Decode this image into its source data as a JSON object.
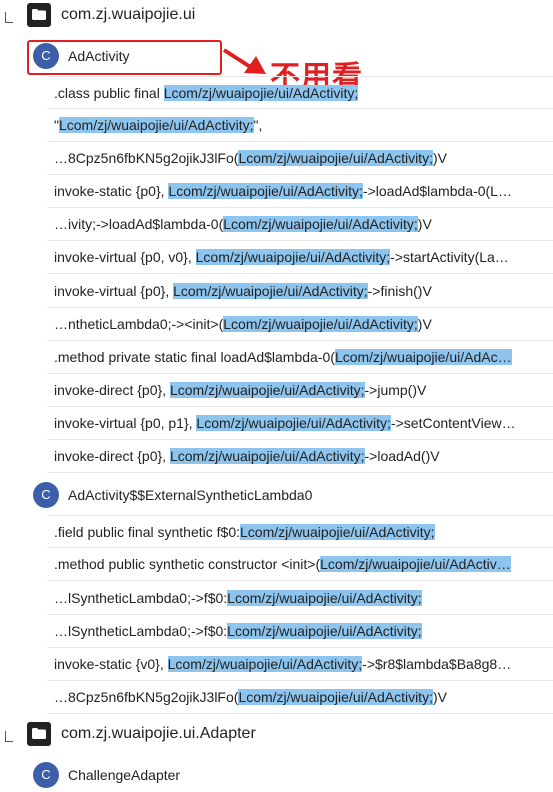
{
  "annotation": {
    "note": "不用看",
    "box_color": "#e02020"
  },
  "colors": {
    "highlight": "#8ec5ef",
    "class_icon": "#3d5ea8"
  },
  "tree": [
    {
      "kind": "package",
      "label": "com.zj.wuaipojie.ui"
    },
    {
      "kind": "class",
      "icon": "C",
      "label": "AdActivity",
      "hits": [
        {
          "pre": ".class public final ",
          "match": "Lcom/zj/wuaipojie/ui/AdActivity;",
          "post": ""
        },
        {
          "pre": "\"",
          "match": "Lcom/zj/wuaipojie/ui/AdActivity;",
          "post": "\","
        },
        {
          "pre": "…8Cpz5n6fbKN5g2ojikJ3lFo(",
          "match": "Lcom/zj/wuaipojie/ui/AdActivity;",
          "post": ")V"
        },
        {
          "pre": "invoke-static {p0}, ",
          "match": "Lcom/zj/wuaipojie/ui/AdActivity;",
          "post": "->loadAd$lambda-0(L…"
        },
        {
          "pre": "…ivity;->loadAd$lambda-0(",
          "match": "Lcom/zj/wuaipojie/ui/AdActivity;",
          "post": ")V"
        },
        {
          "pre": "invoke-virtual {p0, v0}, ",
          "match": "Lcom/zj/wuaipojie/ui/AdActivity;",
          "post": "->startActivity(La…"
        },
        {
          "pre": "invoke-virtual {p0}, ",
          "match": "Lcom/zj/wuaipojie/ui/AdActivity;",
          "post": "->finish()V"
        },
        {
          "pre": "…ntheticLambda0;-><init>(",
          "match": "Lcom/zj/wuaipojie/ui/AdActivity;",
          "post": ")V"
        },
        {
          "pre": ".method private static final loadAd$lambda-0(",
          "match": "Lcom/zj/wuaipojie/ui/AdAc…",
          "post": ""
        },
        {
          "pre": "invoke-direct {p0}, ",
          "match": "Lcom/zj/wuaipojie/ui/AdActivity;",
          "post": "->jump()V"
        },
        {
          "pre": "invoke-virtual {p0, p1}, ",
          "match": "Lcom/zj/wuaipojie/ui/AdActivity;",
          "post": "->setContentView…"
        },
        {
          "pre": "invoke-direct {p0}, ",
          "match": "Lcom/zj/wuaipojie/ui/AdActivity;",
          "post": "->loadAd()V"
        }
      ]
    },
    {
      "kind": "class",
      "icon": "C",
      "label": "AdActivity$$ExternalSyntheticLambda0",
      "hits": [
        {
          "pre": ".field public final synthetic f$0:",
          "match": "Lcom/zj/wuaipojie/ui/AdActivity;",
          "post": ""
        },
        {
          "pre": ".method public synthetic constructor <init>(",
          "match": "Lcom/zj/wuaipojie/ui/AdActiv…",
          "post": ""
        },
        {
          "pre": "…lSyntheticLambda0;->f$0:",
          "match": "Lcom/zj/wuaipojie/ui/AdActivity;",
          "post": ""
        },
        {
          "pre": "…lSyntheticLambda0;->f$0:",
          "match": "Lcom/zj/wuaipojie/ui/AdActivity;",
          "post": ""
        },
        {
          "pre": "invoke-static {v0}, ",
          "match": "Lcom/zj/wuaipojie/ui/AdActivity;",
          "post": "->$r8$lambda$Ba8g8…"
        },
        {
          "pre": "…8Cpz5n6fbKN5g2ojikJ3lFo(",
          "match": "Lcom/zj/wuaipojie/ui/AdActivity;",
          "post": ")V"
        }
      ]
    },
    {
      "kind": "package",
      "label": "com.zj.wuaipojie.ui.Adapter"
    },
    {
      "kind": "class",
      "icon": "C",
      "label": "ChallengeAdapter",
      "hits": []
    }
  ]
}
